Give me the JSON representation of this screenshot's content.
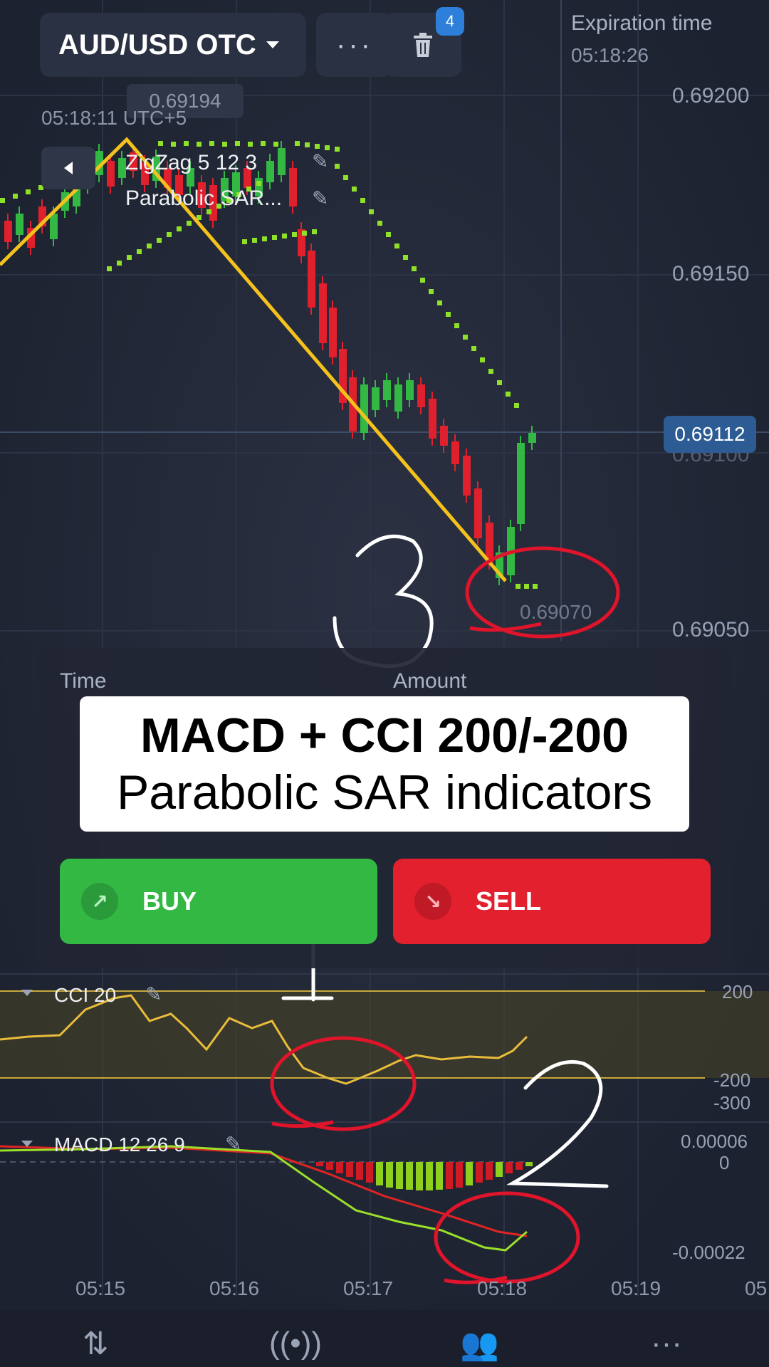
{
  "header": {
    "pair": "AUD/USD OTC",
    "more_label": "···",
    "badge": "4",
    "expiration_label": "Expiration time",
    "expiration_value": "05:18:26"
  },
  "chart": {
    "utc_time": "05:18:11 UTC+5",
    "high_marker": "0.69194",
    "indicators": [
      "ZigZag 5 12 3",
      "Parabolic SAR..."
    ],
    "price_levels": [
      "0.69200",
      "0.69150",
      "0.69100",
      "0.69050"
    ],
    "current_price": "0.69112",
    "low_marker": "0.69070"
  },
  "trade_panel": {
    "time_label": "Time",
    "amount_label": "Amount",
    "buy_label": "BUY",
    "sell_label": "SELL"
  },
  "caption": {
    "line1": "MACD + CCI 200/-200",
    "line2": "Parabolic SAR indicators"
  },
  "annotations": [
    "1",
    "2",
    "3"
  ],
  "cci": {
    "label": "CCI 20",
    "levels": [
      "200",
      "-200",
      "-300"
    ]
  },
  "macd": {
    "label": "MACD 12 26 9",
    "levels": [
      "0.00006",
      "0",
      "-0.00022"
    ]
  },
  "time_axis": [
    "05:15",
    "05:16",
    "05:17",
    "05:18",
    "05:19",
    "05"
  ],
  "colors": {
    "buy": "#33b844",
    "sell": "#e2202e",
    "zigzag": "#f4c21c",
    "sar": "#8fe028",
    "annotation_circle": "#e0142a"
  },
  "nav_icons": [
    "swap-arrows-icon",
    "signal-icon",
    "users-icon",
    "more-icon"
  ]
}
